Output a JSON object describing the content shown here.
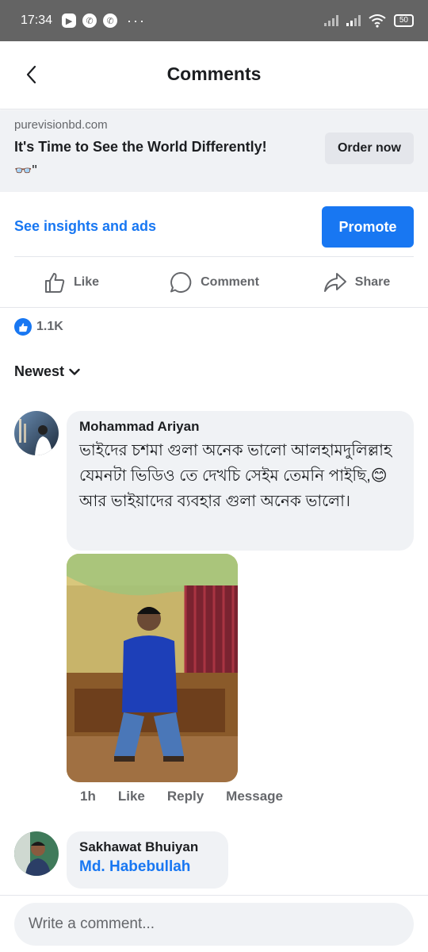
{
  "status_bar": {
    "time": "17:34",
    "notification_icons": [
      "youtube-icon",
      "viber-icon",
      "whatsapp-icon"
    ],
    "overflow": "···",
    "battery": "50"
  },
  "header": {
    "title": "Comments",
    "back_icon": "chevron-left-icon"
  },
  "ad": {
    "domain": "purevisionbd.com",
    "headline": "It's Time to See the World Differently!",
    "glasses": "👓\"",
    "cta_label": "Order now"
  },
  "insights": {
    "label": "See insights and ads",
    "promote_label": "Promote"
  },
  "actions": {
    "like": "Like",
    "comment": "Comment",
    "share": "Share"
  },
  "reactions": {
    "count": "1.1K"
  },
  "sort": {
    "label": "Newest"
  },
  "comments": [
    {
      "author": "Mohammad Ariyan",
      "text": "ভাইদের চশমা গুলা অনেক ভালো আলহামদুলিল্লাহ যেমনটা ভিডিও তে দেখচি সেইম তেমনি পাইছি,😊 আর ভাইয়াদের ব্যবহার গুলা অনেক ভালো।",
      "time": "1h",
      "like_label": "Like",
      "reply_label": "Reply",
      "message_label": "Message"
    },
    {
      "author": "Sakhawat Bhuiyan",
      "mention": "Md. Habebullah"
    }
  ],
  "composer": {
    "placeholder": "Write a comment..."
  },
  "colors": {
    "accent": "#1877f2",
    "bubble": "#f0f2f5",
    "muted_text": "#65676b"
  }
}
